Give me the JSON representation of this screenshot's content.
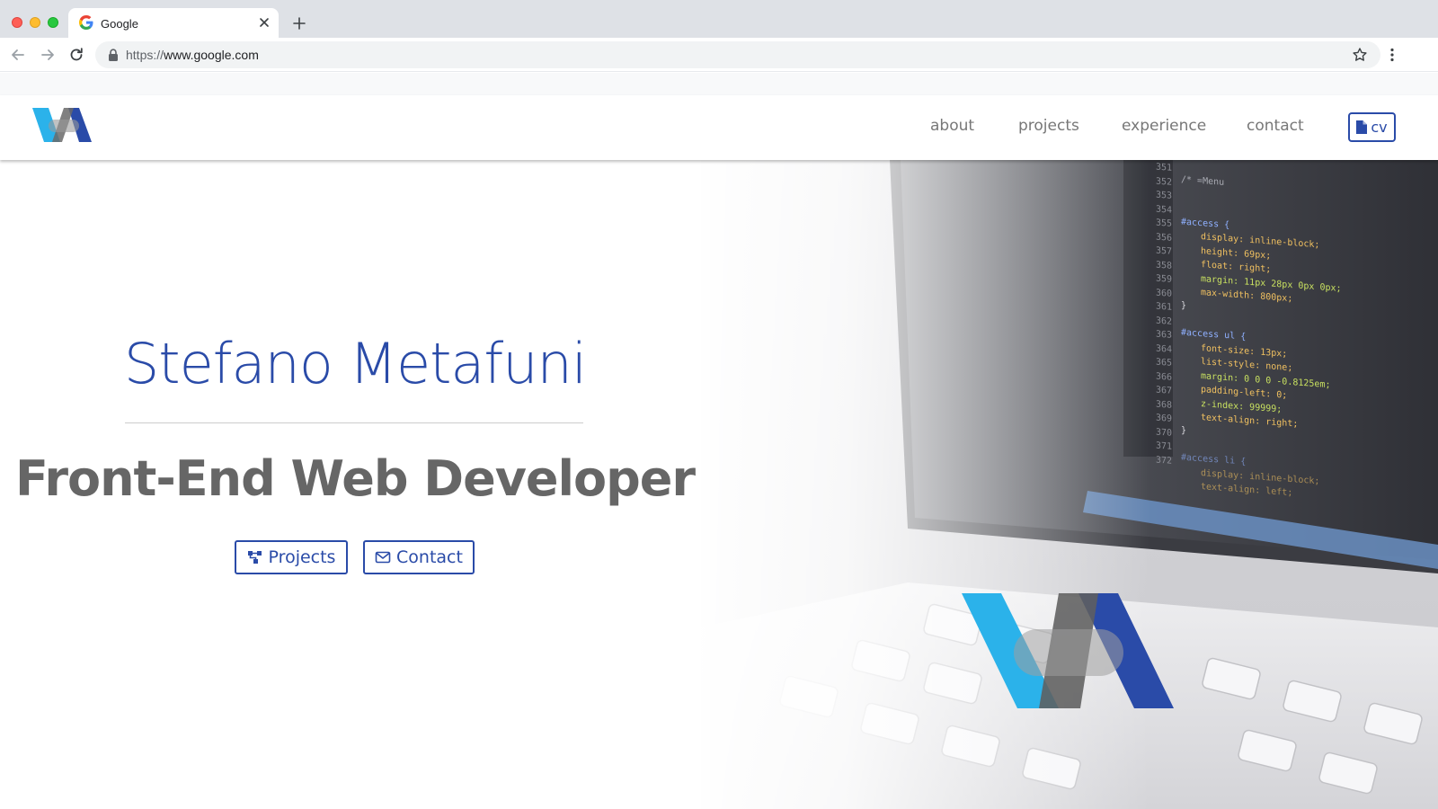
{
  "browser": {
    "tab_title": "Google",
    "url_scheme": "https://",
    "url_host": "www.google.com",
    "icons": [
      "google-favicon",
      "close-icon",
      "plus-icon",
      "back-arrow-icon",
      "forward-arrow-icon",
      "reload-icon",
      "lock-icon",
      "star-icon",
      "vertical-dots-icon"
    ]
  },
  "header": {
    "nav": {
      "about": "about",
      "projects": "projects",
      "experience": "experience",
      "contact": "contact"
    },
    "cv_label": "cv"
  },
  "hero": {
    "name": "Stefano Metafuni",
    "role": "Front-End Web Developer",
    "projects_label": "Projects",
    "contact_label": "Contact",
    "code_lines": [
      "/* =Menu",
      "#access {",
      "display: inline-block;",
      "height: 69px;",
      "float: right;",
      "margin: 11px 28px 0px 0px;",
      "max-width: 800px;",
      "}",
      "#access ul {",
      "font-size: 13px;",
      "list-style: none;",
      "margin: 0 0 0 -0.8125em;",
      "padding-left: 0;",
      "z-index: 99999;",
      "text-align: right;",
      "}",
      "#access li {",
      "display: inline-block;",
      "text-align: left;"
    ],
    "line_numbers": [
      "351",
      "352",
      "353",
      "354",
      "355",
      "356",
      "357",
      "358",
      "359",
      "360",
      "361",
      "362",
      "363",
      "364",
      "365",
      "366",
      "367",
      "368",
      "369",
      "370",
      "371",
      "372"
    ]
  },
  "colors": {
    "brand_dark": "#2a4ba8",
    "brand_light": "#2bb2ea",
    "brand_gray": "#6a6a6a",
    "text_gray": "#666666",
    "nav_gray": "#777777"
  }
}
